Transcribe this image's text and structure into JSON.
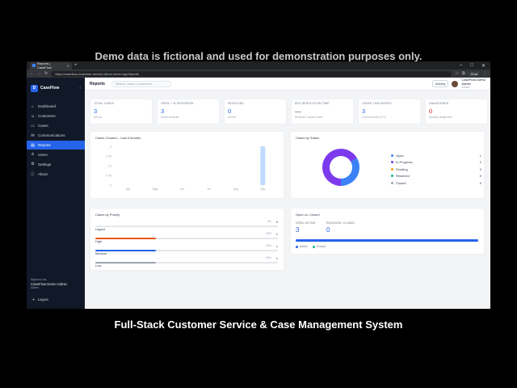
{
  "overlay": {
    "top_caption": "Demo data is fictional and used for demonstration purposes only.",
    "bottom_caption": "Full-Stack Customer Service & Case Management System"
  },
  "browser": {
    "tab_title": "Reports | CaseFlow",
    "url": "https://caseflow-customer-service-demo.vercel.app/reports",
    "chat_label": "Chat"
  },
  "app": {
    "brand": "CaseFlow",
    "nav": [
      "Dashboard",
      "Customers",
      "Cases",
      "Communications",
      "Reports",
      "Users",
      "Settings",
      "About"
    ],
    "nav_icons": [
      "home-icon",
      "users-icon",
      "folder-icon",
      "chat-icon",
      "chart-icon",
      "user-icon",
      "gear-icon",
      "info-icon"
    ],
    "active_nav": "Reports",
    "signed_in_label": "Signed in as",
    "signed_in_user": "CaseFlow Demo Admin",
    "signed_in_role": "Admin",
    "logout": "Logout"
  },
  "topbar": {
    "title": "Reports",
    "search_placeholder": "Search cases, customers...",
    "activity": "Activity",
    "user_name": "CaseFlow Demo",
    "user_name2": "Admin",
    "user_role": "Admin"
  },
  "stats": [
    {
      "label": "Total Cases",
      "value": "3",
      "sub": "All time",
      "color": "#2563eb"
    },
    {
      "label": "Open + In Progress",
      "value": "3",
      "sub": "Active workload",
      "color": "#2563eb"
    },
    {
      "label": "Resolved",
      "value": "0",
      "sub": "All time",
      "color": "#2563eb"
    },
    {
      "label": "Avg Resolution Time",
      "value": "—",
      "sub": "Resolved / closed cases",
      "color": "#374151"
    },
    {
      "label": "Cases This Month",
      "value": "3",
      "sub": "Current month (UTC)",
      "color": "#2563eb"
    },
    {
      "label": "Unassigned",
      "value": "0",
      "sub": "Needing assignment",
      "color": "#dc2626"
    }
  ],
  "cases_created": {
    "title": "Cases Created – Last 6 Months",
    "yticks": [
      "3",
      "2.25",
      "1.5",
      "0.75",
      "0"
    ]
  },
  "cases_by_status": {
    "title": "Cases by Status",
    "items": [
      {
        "name": "Open",
        "value": 1,
        "color": "#3b82f6"
      },
      {
        "name": "In Progress",
        "value": 2,
        "color": "#7c3aed"
      },
      {
        "name": "Pending",
        "value": 0,
        "color": "#f59e0b"
      },
      {
        "name": "Resolved",
        "value": 0,
        "color": "#10b981"
      },
      {
        "name": "Closed",
        "value": 0,
        "color": "#9ca3af"
      }
    ]
  },
  "cases_by_priority": {
    "title": "Cases by Priority",
    "rows": [
      {
        "name": "Urgent",
        "pct": "0%",
        "count": "0",
        "fraction": 0,
        "color": "#dc2626"
      },
      {
        "name": "High",
        "pct": "33%",
        "count": "1",
        "fraction": 0.333,
        "color": "#ea580c"
      },
      {
        "name": "Medium",
        "pct": "33%",
        "count": "1",
        "fraction": 0.333,
        "color": "#2563eb"
      },
      {
        "name": "Low",
        "pct": "33%",
        "count": "1",
        "fraction": 0.333,
        "color": "#9ca3af"
      }
    ]
  },
  "open_vs_closed": {
    "title": "Open vs. Closed",
    "open_label": "Open / Active",
    "open_value": "3",
    "closed_label": "Resolved / Closed",
    "closed_value": "0",
    "active_fraction": 1,
    "legend_active": "Active",
    "legend_closed": "Closed"
  },
  "chart_data": [
    {
      "type": "bar",
      "title": "Cases Created – Last 6 Months",
      "categories": [
        "Apr",
        "May",
        "Jun",
        "Jul",
        "Aug",
        "Sep"
      ],
      "values": [
        0,
        0,
        0,
        0,
        0,
        3
      ],
      "ylim": [
        0,
        3
      ],
      "xlabel": "",
      "ylabel": ""
    },
    {
      "type": "pie",
      "title": "Cases by Status",
      "categories": [
        "Open",
        "In Progress",
        "Pending",
        "Resolved",
        "Closed"
      ],
      "values": [
        1,
        2,
        0,
        0,
        0
      ],
      "legend": "right"
    }
  ]
}
